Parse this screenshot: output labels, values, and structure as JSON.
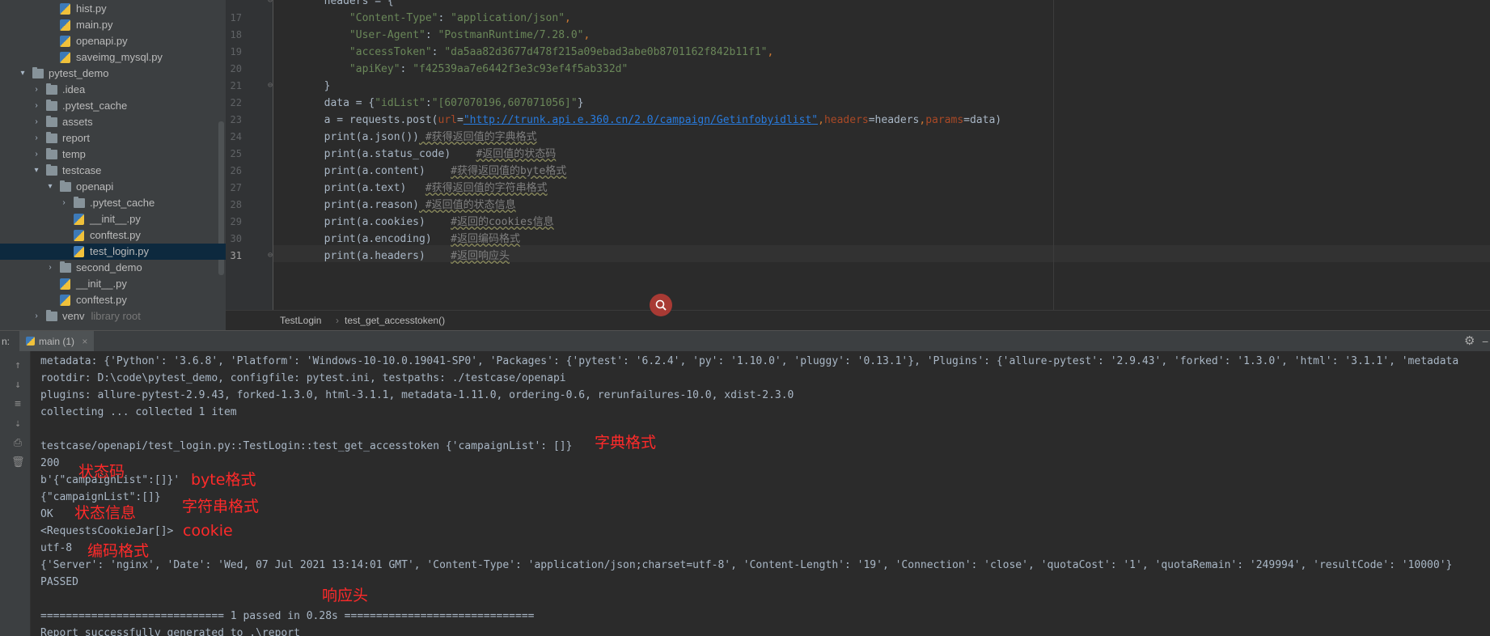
{
  "project_tree": [
    {
      "label": "hist.py",
      "type": "py",
      "indent": 2,
      "arrow": ""
    },
    {
      "label": "main.py",
      "type": "py",
      "indent": 2,
      "arrow": ""
    },
    {
      "label": "openapi.py",
      "type": "py",
      "indent": 2,
      "arrow": ""
    },
    {
      "label": "saveimg_mysql.py",
      "type": "py",
      "indent": 2,
      "arrow": ""
    },
    {
      "label": "pytest_demo",
      "type": "folder",
      "indent": 0,
      "arrow": "▾"
    },
    {
      "label": ".idea",
      "type": "folder",
      "indent": 1,
      "arrow": "›"
    },
    {
      "label": ".pytest_cache",
      "type": "folder",
      "indent": 1,
      "arrow": "›"
    },
    {
      "label": "assets",
      "type": "folder",
      "indent": 1,
      "arrow": "›"
    },
    {
      "label": "report",
      "type": "folder",
      "indent": 1,
      "arrow": "›"
    },
    {
      "label": "temp",
      "type": "folder",
      "indent": 1,
      "arrow": "›"
    },
    {
      "label": "testcase",
      "type": "folder",
      "indent": 1,
      "arrow": "▾"
    },
    {
      "label": "openapi",
      "type": "folder",
      "indent": 2,
      "arrow": "▾"
    },
    {
      "label": ".pytest_cache",
      "type": "folder",
      "indent": 3,
      "arrow": "›"
    },
    {
      "label": "__init__.py",
      "type": "py",
      "indent": 3,
      "arrow": ""
    },
    {
      "label": "conftest.py",
      "type": "py",
      "indent": 3,
      "arrow": ""
    },
    {
      "label": "test_login.py",
      "type": "py",
      "indent": 3,
      "arrow": "",
      "selected": true
    },
    {
      "label": "second_demo",
      "type": "folder",
      "indent": 2,
      "arrow": "›"
    },
    {
      "label": "__init__.py",
      "type": "py",
      "indent": 2,
      "arrow": ""
    },
    {
      "label": "conftest.py",
      "type": "py",
      "indent": 2,
      "arrow": ""
    },
    {
      "label": "venv",
      "type": "folder",
      "indent": 1,
      "arrow": "›",
      "suffix": "library root"
    }
  ],
  "editor": {
    "line_numbers": [
      "",
      "17",
      "18",
      "19",
      "20",
      "21",
      "22",
      "23",
      "24",
      "25",
      "26",
      "27",
      "28",
      "29",
      "30",
      "31"
    ],
    "current_line": "31",
    "lines": [
      [
        {
          "t": "        headers = {",
          "c": ""
        }
      ],
      [
        {
          "t": "            ",
          "c": ""
        },
        {
          "t": "\"Content-Type\"",
          "c": "s"
        },
        {
          "t": ": ",
          "c": ""
        },
        {
          "t": "\"application/json\"",
          "c": "s"
        },
        {
          "t": ",",
          "c": "k"
        }
      ],
      [
        {
          "t": "            ",
          "c": ""
        },
        {
          "t": "\"User-Agent\"",
          "c": "s"
        },
        {
          "t": ": ",
          "c": ""
        },
        {
          "t": "\"PostmanRuntime/7.28.0\"",
          "c": "s"
        },
        {
          "t": ",",
          "c": "k"
        }
      ],
      [
        {
          "t": "            ",
          "c": ""
        },
        {
          "t": "\"accessToken\"",
          "c": "s"
        },
        {
          "t": ": ",
          "c": ""
        },
        {
          "t": "\"da5aa82d3677d478f215a09ebad3abe0b8701162f842b11f1\"",
          "c": "s"
        },
        {
          "t": ",",
          "c": "k"
        }
      ],
      [
        {
          "t": "            ",
          "c": ""
        },
        {
          "t": "\"apiKey\"",
          "c": "s"
        },
        {
          "t": ": ",
          "c": ""
        },
        {
          "t": "\"f42539aa7e6442f3e3c93ef4f5ab332d\"",
          "c": "s"
        }
      ],
      [
        {
          "t": "        }",
          "c": ""
        }
      ],
      [
        {
          "t": "        data = {",
          "c": ""
        },
        {
          "t": "\"idList\"",
          "c": "s"
        },
        {
          "t": ":",
          "c": ""
        },
        {
          "t": "\"[607070196,607071056]\"",
          "c": "s"
        },
        {
          "t": "}",
          "c": ""
        }
      ],
      [
        {
          "t": "        a = requests.post(",
          "c": ""
        },
        {
          "t": "url",
          "c": "p"
        },
        {
          "t": "=",
          "c": ""
        },
        {
          "t": "\"http://trunk.api.e.360.cn/2.0/campaign/Getinfobyidlist\"",
          "c": "u"
        },
        {
          "t": ",",
          "c": "k"
        },
        {
          "t": "headers",
          "c": "p"
        },
        {
          "t": "=headers",
          "c": ""
        },
        {
          "t": ",",
          "c": "k"
        },
        {
          "t": "params",
          "c": "p"
        },
        {
          "t": "=data)",
          "c": ""
        }
      ],
      [
        {
          "t": "        print(a.json())",
          "c": ""
        },
        {
          "t": " #获得返回值的字典格式",
          "c": "c"
        }
      ],
      [
        {
          "t": "        print(a.status_code)    ",
          "c": ""
        },
        {
          "t": "#返回值的状态码",
          "c": "c"
        }
      ],
      [
        {
          "t": "        print(a.content)    ",
          "c": ""
        },
        {
          "t": "#获得返回值的byte格式",
          "c": "c"
        }
      ],
      [
        {
          "t": "        print(a.text)   ",
          "c": ""
        },
        {
          "t": "#获得返回值的字符串格式",
          "c": "c"
        }
      ],
      [
        {
          "t": "        print(a.reason)",
          "c": ""
        },
        {
          "t": " #返回值的状态信息",
          "c": "c"
        }
      ],
      [
        {
          "t": "        print(a.cookies)    ",
          "c": ""
        },
        {
          "t": "#返回的cookies信息",
          "c": "c"
        }
      ],
      [
        {
          "t": "        print(a.encoding)   ",
          "c": ""
        },
        {
          "t": "#返回编码格式",
          "c": "c"
        }
      ],
      [
        {
          "t": "        print(a.headers)    ",
          "c": ""
        },
        {
          "t": "#返回响应头",
          "c": "c"
        }
      ]
    ]
  },
  "breadcrumb": {
    "class_name": "TestLogin",
    "separator": "›",
    "method_name": "test_get_accesstoken()"
  },
  "run_panel": {
    "prefix": "n:",
    "tab_label": "main (1)",
    "close_glyph": "×",
    "settings_glyph": "⚙",
    "minimize_glyph": "−"
  },
  "tool_icons": [
    "↑",
    "↓",
    "≡",
    "⇣",
    "⎙",
    "🗑"
  ],
  "console_lines": [
    "metadata: {'Python': '3.6.8', 'Platform': 'Windows-10-10.0.19041-SP0', 'Packages': {'pytest': '6.2.4', 'py': '1.10.0', 'pluggy': '0.13.1'}, 'Plugins': {'allure-pytest': '2.9.43', 'forked': '1.3.0', 'html': '3.1.1', 'metadata",
    "rootdir: D:\\code\\pytest_demo, configfile: pytest.ini, testpaths: ./testcase/openapi",
    "plugins: allure-pytest-2.9.43, forked-1.3.0, html-3.1.1, metadata-1.11.0, ordering-0.6, rerunfailures-10.0, xdist-2.3.0",
    "collecting ... collected 1 item",
    "",
    "testcase/openapi/test_login.py::TestLogin::test_get_accesstoken {'campaignList': []}",
    "200",
    "b'{\"campaignList\":[]}'",
    "{\"campaignList\":[]}",
    "OK",
    "<RequestsCookieJar[]>",
    "utf-8",
    "{'Server': 'nginx', 'Date': 'Wed, 07 Jul 2021 13:14:01 GMT', 'Content-Type': 'application/json;charset=utf-8', 'Content-Length': '19', 'Connection': 'close', 'quotaCost': '1', 'quotaRemain': '249994', 'resultCode': '10000'}",
    "PASSED",
    "",
    "============================= 1 passed in 0.28s ==============================",
    "Report successfully generated to .\\report"
  ],
  "annotations": [
    {
      "text": "字典格式",
      "name": "annotation-dict-format"
    },
    {
      "text": "状态码",
      "name": "annotation-status-code"
    },
    {
      "text": "byte格式",
      "name": "annotation-byte-format"
    },
    {
      "text": "字符串格式",
      "name": "annotation-string-format"
    },
    {
      "text": "状态信息",
      "name": "annotation-status-info"
    },
    {
      "text": "cookie",
      "name": "annotation-cookie"
    },
    {
      "text": "编码格式",
      "name": "annotation-encoding-format"
    },
    {
      "text": "响应头",
      "name": "annotation-response-headers"
    }
  ]
}
